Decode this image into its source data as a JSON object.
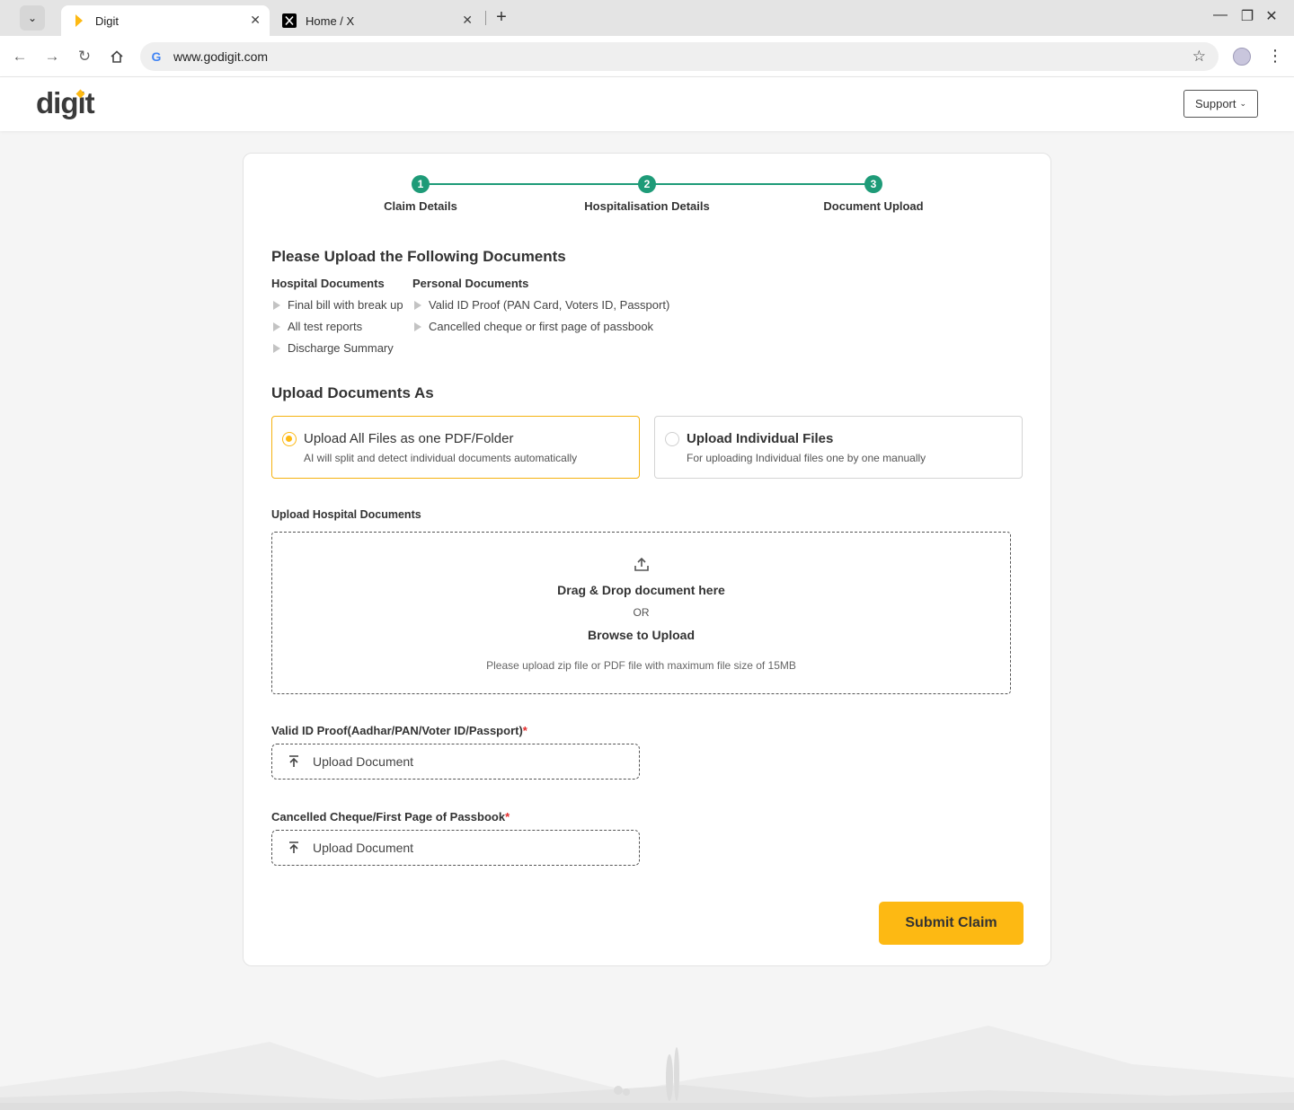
{
  "browser": {
    "tabs": [
      {
        "title": "Digit",
        "active": true
      },
      {
        "title": "Home / X",
        "active": false
      }
    ],
    "url": "www.godigit.com"
  },
  "site": {
    "logo_text": "digit",
    "support_label": "Support"
  },
  "stepper": {
    "steps": [
      {
        "number": "1",
        "label": "Claim Details"
      },
      {
        "number": "2",
        "label": "Hospitalisation Details"
      },
      {
        "number": "3",
        "label": "Document Upload"
      }
    ]
  },
  "documents": {
    "title": "Please Upload the Following Documents",
    "hospital": {
      "heading": "Hospital Documents",
      "items": [
        "Final bill with break up",
        "All test reports",
        "Discharge Summary"
      ]
    },
    "personal": {
      "heading": "Personal Documents",
      "items": [
        "Valid ID Proof (PAN Card, Voters ID, Passport)",
        "Cancelled cheque or first page of passbook"
      ]
    }
  },
  "upload_as": {
    "title": "Upload Documents As",
    "options": [
      {
        "title": "Upload All Files as one PDF/Folder",
        "subtitle": "AI will split and detect individual documents automatically",
        "selected": true
      },
      {
        "title": "Upload Individual Files",
        "subtitle": "For uploading Individual files one by one manually",
        "selected": false
      }
    ]
  },
  "hospital_upload": {
    "label": "Upload Hospital Documents",
    "drag_text": "Drag & Drop document here",
    "or_text": "OR",
    "browse_text": "Browse to Upload",
    "note": "Please upload zip file or PDF file with maximum file size of 15MB"
  },
  "id_proof": {
    "label": "Valid ID Proof(Aadhar/PAN/Voter ID/Passport)",
    "required_mark": "*",
    "button_text": "Upload Document"
  },
  "cheque": {
    "label": "Cancelled Cheque/First Page of Passbook",
    "required_mark": "*",
    "button_text": "Upload Document"
  },
  "submit_label": "Submit Claim",
  "colors": {
    "brand_yellow": "#fdb913",
    "step_green": "#1e9b78",
    "required_red": "#e32b2b"
  }
}
